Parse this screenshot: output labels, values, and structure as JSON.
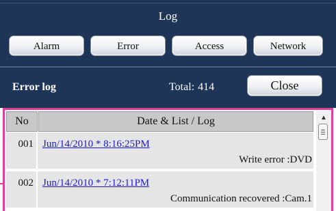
{
  "header": {
    "title": "Log",
    "tabs": [
      {
        "label": "Alarm"
      },
      {
        "label": "Error"
      },
      {
        "label": "Access"
      },
      {
        "label": "Network"
      }
    ]
  },
  "status": {
    "section_label": "Error log",
    "total_label": "Total:",
    "total_value": "414",
    "close_label": "Close"
  },
  "table": {
    "columns": {
      "no": "No",
      "entry": "Date & List / Log"
    },
    "rows": [
      {
        "no": "001",
        "date": "Jun/14/2010  * 8:16:25PM",
        "message": "Write error :DVD"
      },
      {
        "no": "002",
        "date": "Jun/14/2010  * 7:12:11PM",
        "message": "Communication recovered :Cam.1"
      }
    ]
  },
  "colors": {
    "panel_background": "#1e3557",
    "highlight_frame": "#e0409a",
    "link": "#1a1ad6"
  }
}
